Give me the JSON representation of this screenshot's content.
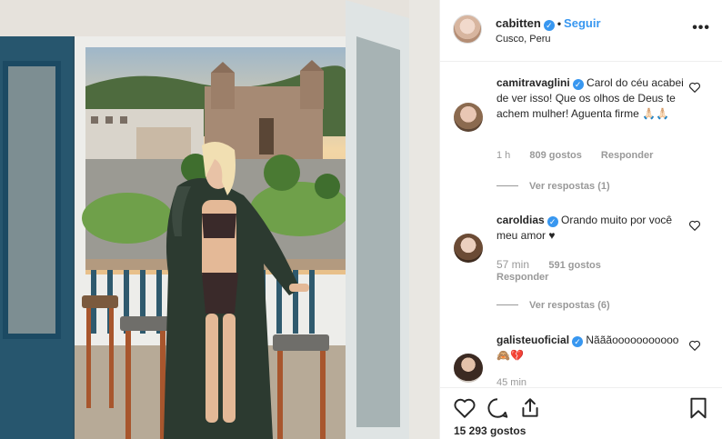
{
  "post": {
    "username": "cabitten",
    "verified_mark": "✓",
    "separator": "•",
    "follow_label": "Seguir",
    "location": "Cusco, Peru",
    "more_icon": "ellipsis-icon",
    "likes": "15 293 gostos"
  },
  "comments": [
    {
      "username": "camitravaglini",
      "text": "Carol do céu acabei de ver isso! Que os olhos de Deus te achem mulher! Aguenta firme 🙏🏻🙏🏻",
      "time": "1 h",
      "likes": "809 gostos",
      "reply": "Responder",
      "view_replies": "Ver respostas (1)"
    },
    {
      "username": "caroldias",
      "text": "Orando muito por você meu amor ♥",
      "time": "57 min",
      "likes": "591 gostos",
      "reply": "Responder",
      "view_replies": "Ver respostas (6)"
    },
    {
      "username": "galisteuoficial",
      "text": "Nãããooooooooooo 🙈💔",
      "time": "45 min",
      "likes": "",
      "reply": "",
      "view_replies": ""
    }
  ],
  "colors": {
    "accent": "#3897f0",
    "muted": "#999999",
    "text": "#262626",
    "border": "#efefef"
  },
  "icons": [
    "heart-icon",
    "comment-icon",
    "share-icon",
    "bookmark-icon"
  ]
}
